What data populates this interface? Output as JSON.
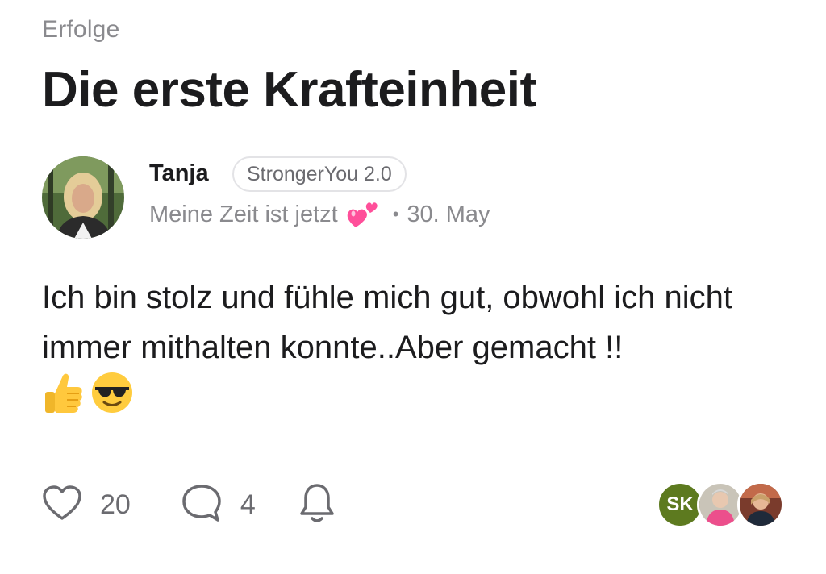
{
  "post": {
    "category": "Erfolge",
    "title": "Die erste Krafteinheit",
    "author": {
      "name": "Tanja",
      "badge": "StrongerYou 2.0",
      "status": "Meine Zeit ist jetzt",
      "status_emoji": "two-hearts-icon",
      "date": "30. May"
    },
    "body": "Ich bin stolz und fühle mich gut, obwohl ich nicht immer mithalten konnte..Aber gemacht !!",
    "body_emojis": [
      "thumbs-up-icon",
      "sunglasses-face-icon"
    ]
  },
  "actions": {
    "likes": "20",
    "comments": "4"
  },
  "participants": [
    {
      "initials": "SK",
      "color": "#5d7a1f"
    },
    {
      "initials": "",
      "color": "#e8a0a8"
    },
    {
      "initials": "",
      "color": "#8a4a3a"
    }
  ]
}
